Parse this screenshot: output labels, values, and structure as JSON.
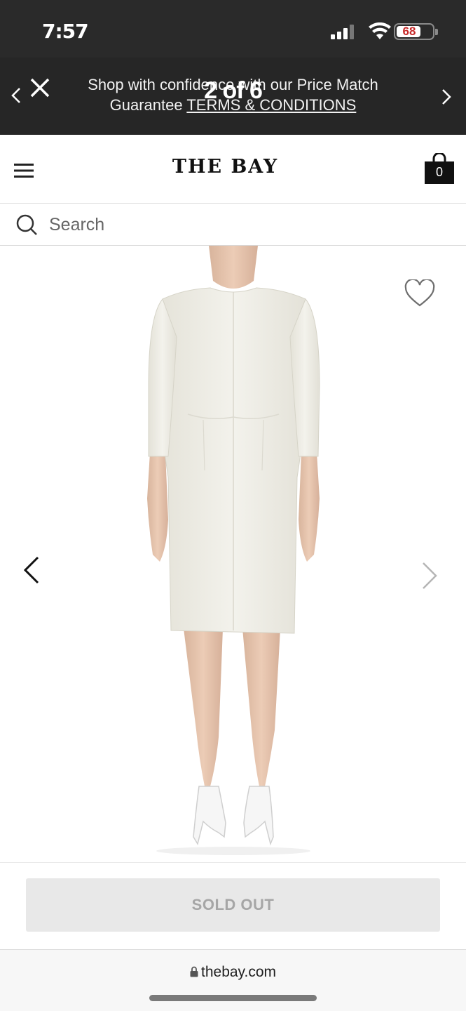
{
  "status_bar": {
    "time": "7:57",
    "battery_percent": "68",
    "battery_level": 0.68
  },
  "promo_banner": {
    "text": "Shop with confidence with our Price Match Guarantee",
    "link_label": "TERMS & CONDITIONS",
    "counter": "2 of 6"
  },
  "header": {
    "logo": "THE BAY",
    "bag_count": "0"
  },
  "search": {
    "placeholder": "Search"
  },
  "gallery": {
    "image_alt": "white three-quarter sleeve sheath dress, back view",
    "wishlist_icon": "heart-outline-icon",
    "prev_icon": "chevron-left-icon",
    "next_icon": "chevron-right-icon"
  },
  "purchase": {
    "sold_out_label": "SOLD OUT"
  },
  "browser": {
    "url": "thebay.com"
  },
  "colors": {
    "status_bar_bg": "#2a2a2a",
    "banner_bg": "#262626",
    "logo_color": "#111111",
    "dress_color": "#efeee6",
    "sold_out_bg": "#e8e8e8",
    "sold_out_text": "#a6a6a6"
  }
}
